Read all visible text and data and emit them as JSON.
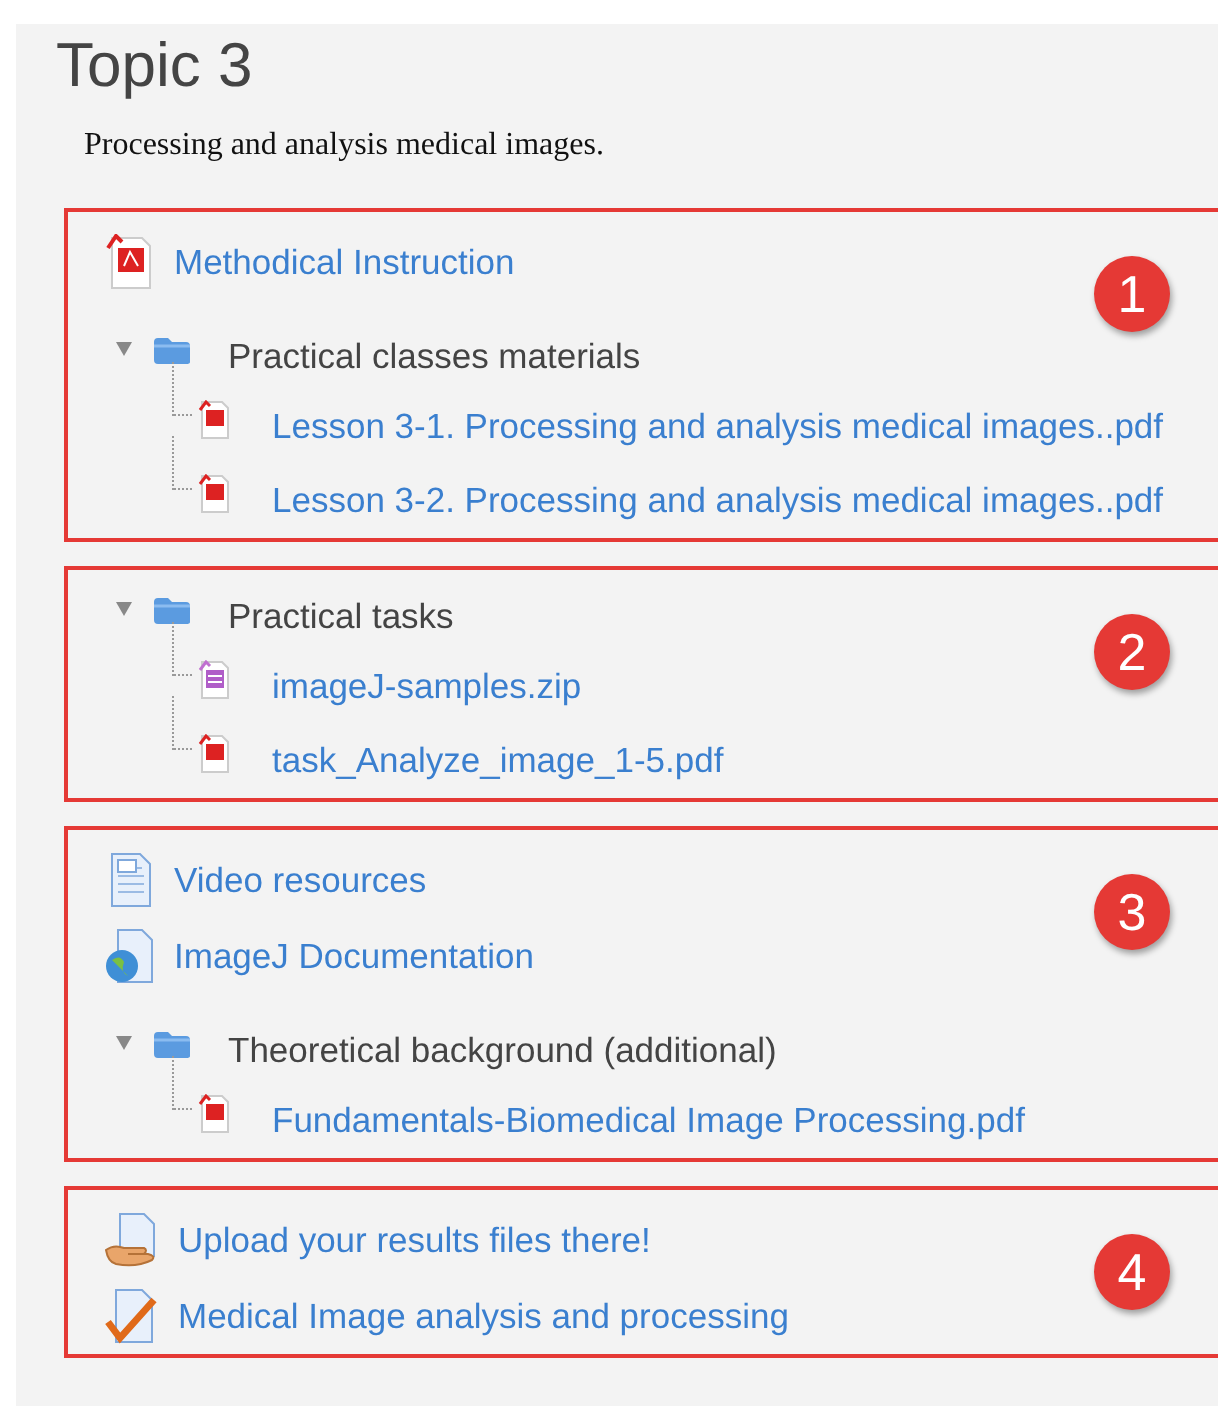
{
  "title": "Topic 3",
  "summary": "Processing and analysis medical images.",
  "groups": [
    {
      "badge": "1",
      "items": [
        {
          "kind": "pdf",
          "label": "Methodical Instruction"
        },
        {
          "kind": "folder",
          "label": "Practical classes materials",
          "expanded": true,
          "children": [
            {
              "kind": "pdf",
              "label": "Lesson 3-1. Processing and analysis medical images..pdf"
            },
            {
              "kind": "pdf",
              "label": "Lesson 3-2. Processing and analysis medical images..pdf"
            }
          ]
        }
      ]
    },
    {
      "badge": "2",
      "items": [
        {
          "kind": "folder",
          "label": "Practical tasks",
          "expanded": true,
          "children": [
            {
              "kind": "zip",
              "label": "imageJ-samples.zip"
            },
            {
              "kind": "pdf",
              "label": "task_Analyze_image_1-5.pdf"
            }
          ]
        }
      ]
    },
    {
      "badge": "3",
      "items": [
        {
          "kind": "page",
          "label": "Video resources"
        },
        {
          "kind": "url",
          "label": "ImageJ Documentation"
        },
        {
          "kind": "folder",
          "label": "Theoretical background (additional)",
          "expanded": true,
          "children": [
            {
              "kind": "pdf",
              "label": "Fundamentals-Biomedical Image Processing.pdf"
            }
          ]
        }
      ]
    },
    {
      "badge": "4",
      "items": [
        {
          "kind": "assign",
          "label": "Upload your results files there!"
        },
        {
          "kind": "quiz",
          "label": "Medical Image analysis and processing"
        }
      ]
    }
  ]
}
